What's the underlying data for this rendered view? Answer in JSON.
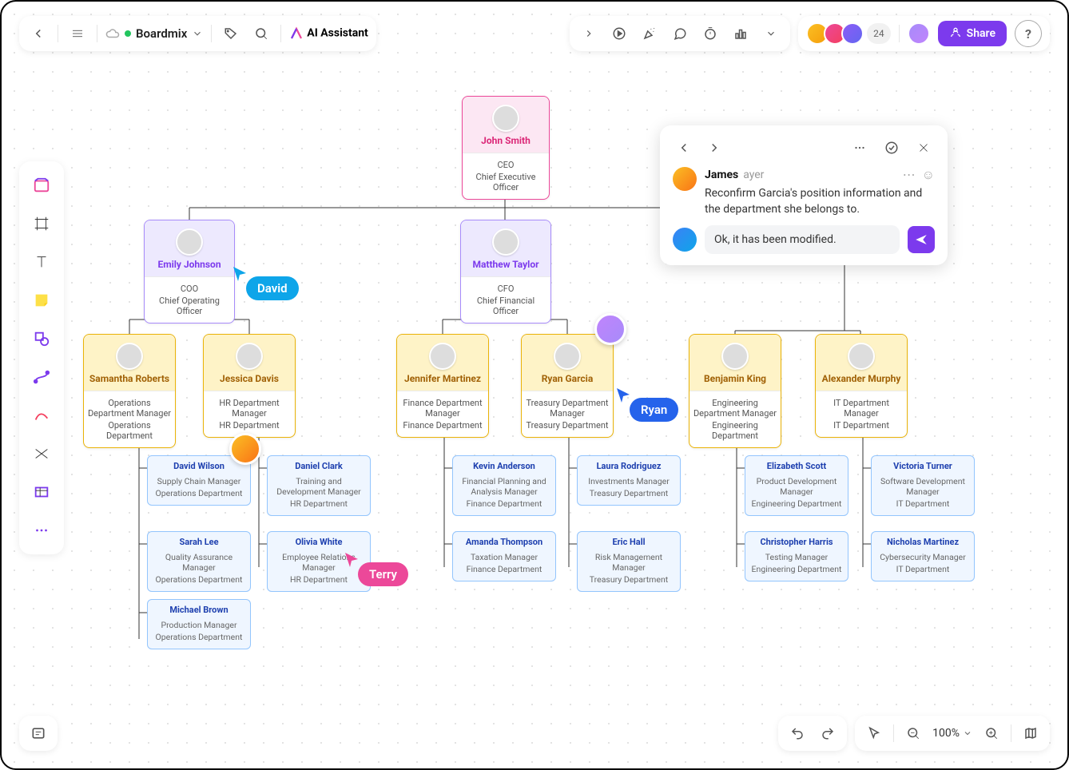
{
  "header": {
    "title": "Boardmix",
    "ai_assistant": "AI Assistant",
    "avatar_extra": "24",
    "share_label": "Share"
  },
  "org": {
    "ceo": {
      "name": "John Smith",
      "role": "CEO",
      "desc": "Chief Executive Officer"
    },
    "coo": {
      "name": "Emily Johnson",
      "role": "COO",
      "desc": "Chief Operating Officer"
    },
    "cfo": {
      "name": "Matthew Taylor",
      "role": "CFO",
      "desc": "Chief Financial Officer"
    },
    "mgrs": [
      {
        "name": "Samantha Roberts",
        "role": "Operations Department Manager",
        "dept": "Operations Department"
      },
      {
        "name": "Jessica Davis",
        "role": "HR Department Manager",
        "dept": "HR Department"
      },
      {
        "name": "Jennifer Martinez",
        "role": "Finance Department Manager",
        "dept": "Finance Department"
      },
      {
        "name": "Ryan Garcia",
        "role": "Treasury Department Manager",
        "dept": "Treasury Department"
      },
      {
        "name": "Benjamin King",
        "role": "Engineering Department Manager",
        "dept": "Engineering Department"
      },
      {
        "name": "Alexander Murphy",
        "role": "IT Department Manager",
        "dept": "IT Department"
      }
    ],
    "subs": [
      {
        "name": "David Wilson",
        "role": "Supply Chain Manager",
        "dept": "Operations Department"
      },
      {
        "name": "Sarah Lee",
        "role": "Quality Assurance Manager",
        "dept": "Operations Department"
      },
      {
        "name": "Michael Brown",
        "role": "Production Manager",
        "dept": "Operations Department"
      },
      {
        "name": "Daniel Clark",
        "role": "Training and Development Manager",
        "dept": "HR Department"
      },
      {
        "name": "Olivia White",
        "role": "Employee Relations Manager",
        "dept": "HR Department"
      },
      {
        "name": "Kevin Anderson",
        "role": "Financial Planning and Analysis Manager",
        "dept": "Finance Department"
      },
      {
        "name": "Amanda Thompson",
        "role": "Taxation Manager",
        "dept": "Finance Department"
      },
      {
        "name": "Laura Rodriguez",
        "role": "Investments Manager",
        "dept": "Treasury Department"
      },
      {
        "name": "Eric Hall",
        "role": "Risk Management Manager",
        "dept": "Treasury Department"
      },
      {
        "name": "Elizabeth Scott",
        "role": "Product Development Manager",
        "dept": "Engineering Department"
      },
      {
        "name": "Christopher Harris",
        "role": "Testing Manager",
        "dept": "Engineering Department"
      },
      {
        "name": "Victoria Turner",
        "role": "Software Development Manager",
        "dept": "IT Department"
      },
      {
        "name": "Nicholas Martinez",
        "role": "Cybersecurity Manager",
        "dept": "IT Department"
      }
    ]
  },
  "cursors": {
    "david": "David",
    "terry": "Terry",
    "ryan": "Ryan"
  },
  "comment": {
    "author": "James",
    "time": "ayer",
    "text": "Reconfirm Garcia's position information and the department she belongs to.",
    "reply_value": "Ok, it has been modified."
  },
  "zoom": "100%"
}
